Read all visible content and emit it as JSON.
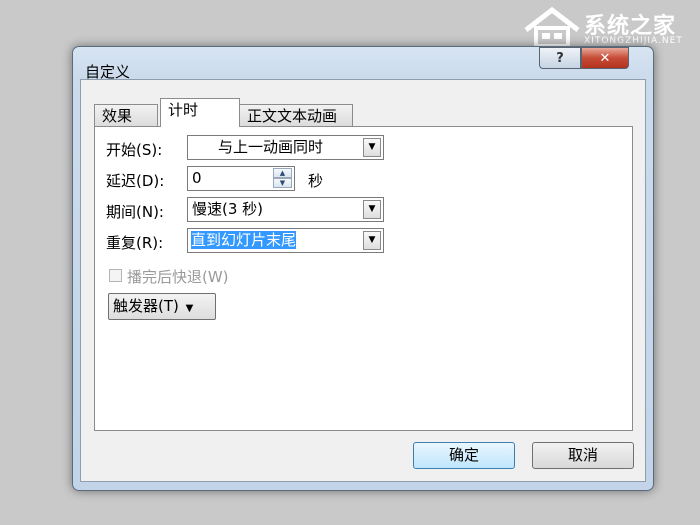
{
  "watermark": {
    "brand": "系统之家",
    "url": "XITONGZHIJIA.NET",
    "icon": "house-logo-icon"
  },
  "dialog": {
    "title": "自定义",
    "help_label": "?",
    "close_label": "✕",
    "tabs": [
      {
        "label": "效果",
        "active": false
      },
      {
        "label": "计时",
        "active": true
      },
      {
        "label": "正文文本动画",
        "active": false
      }
    ],
    "fields": {
      "start": {
        "label": "开始(S):",
        "value": "与上一动画同时"
      },
      "delay": {
        "label": "延迟(D):",
        "value": "0",
        "unit": "秒"
      },
      "duration": {
        "label": "期间(N):",
        "value": "慢速(3 秒)"
      },
      "repeat": {
        "label": "重复(R):",
        "value": "直到幻灯片末尾"
      }
    },
    "rewind": {
      "label": "播完后快退(W)",
      "checked": false,
      "enabled": false
    },
    "trigger_label": "触发器(T)",
    "ok_label": "确定",
    "cancel_label": "取消"
  }
}
